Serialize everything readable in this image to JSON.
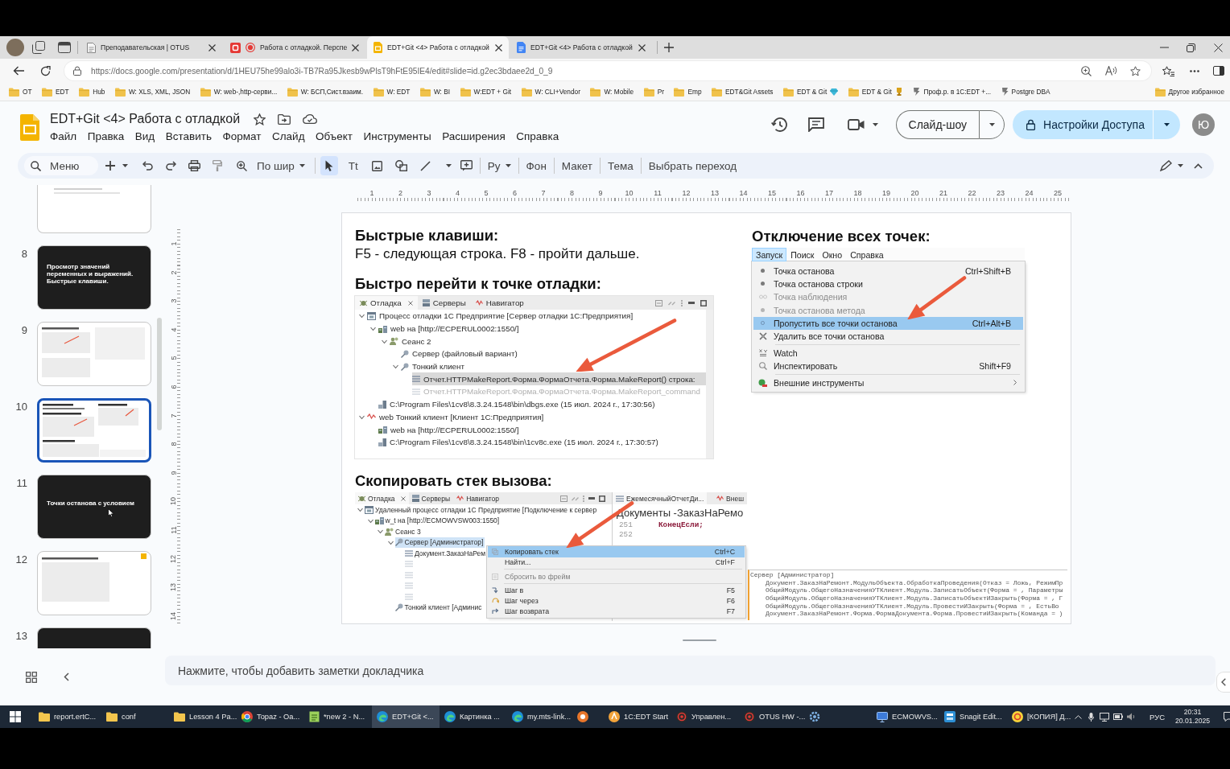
{
  "browser": {
    "tabs": [
      {
        "title": "Преподавательская | OTUS",
        "kind": "page",
        "recording": false,
        "selected": false
      },
      {
        "title": "Работа с отладкой. Перспе",
        "kind": "app",
        "recording": true,
        "selected": false
      },
      {
        "title": "EDT+Git <4> Работа с отладкой",
        "kind": "slides",
        "recording": false,
        "selected": true
      },
      {
        "title": "EDT+Git <4> Работа с отладкой",
        "kind": "docs",
        "recording": false,
        "selected": false
      }
    ],
    "url": "https://docs.google.com/presentation/d/1HEU75he99alo3i-TB7Ra95Jkesb9wPlsT9hFtE95IE4/edit#slide=id.g2ec3bdaee2d_0_9",
    "bookmarks": [
      {
        "label": "OT",
        "kind": "folder"
      },
      {
        "label": "EDT",
        "kind": "folder"
      },
      {
        "label": "Hub",
        "kind": "folder"
      },
      {
        "label": "W: XLS, XML, JSON",
        "kind": "folder"
      },
      {
        "label": "W: web-,http-серви...",
        "kind": "folder"
      },
      {
        "label": "W: БСП,Сист.взаим.",
        "kind": "folder"
      },
      {
        "label": "W: EDT",
        "kind": "folder"
      },
      {
        "label": "W: BI",
        "kind": "folder"
      },
      {
        "label": "W:EDT + Git",
        "kind": "folder"
      },
      {
        "label": "W: CLI+Vendor",
        "kind": "folder"
      },
      {
        "label": "W: Mobile",
        "kind": "folder"
      },
      {
        "label": "Pr",
        "kind": "folder"
      },
      {
        "label": "Emp",
        "kind": "folder"
      },
      {
        "label": "EDT&Git Assets",
        "kind": "folder"
      },
      {
        "label": "EDT & Git",
        "kind": "folder-gem"
      },
      {
        "label": "EDT & Git",
        "kind": "folder-trophy"
      },
      {
        "label": "Проф.р. в 1C:EDT +...",
        "kind": "site"
      },
      {
        "label": "Postgre DBA",
        "kind": "site"
      }
    ],
    "other_bookmarks": "Другое избранное"
  },
  "slides_app": {
    "title": "EDT+Git <4> Работа с отладкой",
    "menus": [
      "Файл",
      "Правка",
      "Вид",
      "Вставить",
      "Формат",
      "Слайд",
      "Объект",
      "Инструменты",
      "Расширения",
      "Справка"
    ],
    "slideshow_button": "Слайд-шоу",
    "share_button": "Настройки Доступа",
    "avatar": "Ю",
    "toolbar": {
      "menu_search": {
        "placeholder": "Меню"
      },
      "zoom": "По шир",
      "tools": [
        {
          "kind": "select",
          "selected": true
        },
        {
          "kind": "textbox",
          "glyph": "Tt",
          "selected": false
        },
        {
          "kind": "image",
          "selected": false
        },
        {
          "kind": "shape",
          "selected": false
        },
        {
          "kind": "line",
          "selected": false
        }
      ],
      "input_tools": "Ру",
      "actions": [
        "Фон",
        "Макет",
        "Тема",
        "Выбрать переход"
      ]
    }
  },
  "filmstrip": {
    "slides": [
      {
        "kind": "light",
        "selected": false
      },
      {
        "number": "8",
        "kind": "dark",
        "title": "Просмотр значений переменных и выражений. Быстрые клавиши.",
        "selected": false
      },
      {
        "number": "9",
        "kind": "light",
        "selected": false
      },
      {
        "number": "10",
        "kind": "light",
        "selected": true
      },
      {
        "number": "11",
        "kind": "dark",
        "title": "Точки останова с условием",
        "selected": false
      },
      {
        "number": "12",
        "kind": "light",
        "selected": false
      },
      {
        "number": "13",
        "kind": "dark",
        "selected": false
      }
    ]
  },
  "rulers": {
    "horizontal": [
      "1",
      "2",
      "3",
      "4",
      "5",
      "6",
      "7",
      "8",
      "9",
      "10",
      "11",
      "12",
      "13",
      "14",
      "15",
      "16",
      "17",
      "18",
      "19",
      "20",
      "21",
      "22",
      "23",
      "24",
      "25"
    ],
    "vertical": [
      "1",
      "2",
      "3",
      "4",
      "5",
      "6",
      "7",
      "8",
      "9",
      "10",
      "11",
      "12",
      "13",
      "14"
    ]
  },
  "slide": {
    "hotkeys": {
      "heading": "Быстрые клавиши:",
      "text": "F5 - следующая строка. F8 - пройти дальше."
    },
    "jump_to_breakpoint": {
      "heading": "Быстро перейти к точке отладки:",
      "view_tabs": [
        {
          "label": "Отладка",
          "kind": "debug",
          "closable": true,
          "selected": true
        },
        {
          "label": "Серверы",
          "kind": "servers",
          "closable": false,
          "selected": false
        },
        {
          "label": "Навигатор",
          "kind": "navigator",
          "closable": false,
          "selected": false
        }
      ],
      "tree": [
        {
          "label": "Процесс отладки 1С Предприятие [Сервер отладки 1С:Предприятия]",
          "kind": "process",
          "expanded": true,
          "selected": false,
          "children": [
            {
              "label": "web на [http://ECPERUL0002:1550/]",
              "kind": "target",
              "expanded": true,
              "selected": false,
              "children": [
                {
                  "label": "Сеанс 2",
                  "kind": "session",
                  "expanded": true,
                  "selected": false,
                  "children": [
                    {
                      "label": "Сервер (файловый вариант)",
                      "kind": "server",
                      "selected": false
                    },
                    {
                      "label": "Тонкий клиент",
                      "kind": "server",
                      "expanded": true,
                      "selected": false,
                      "children": [
                        {
                          "label": "Отчет.HTTPMakeReport.Форма.ФормаОтчета.Форма.MakeReport() строка:",
                          "kind": "frame",
                          "disabled": false,
                          "selected": true
                        },
                        {
                          "label": "Отчет.HTTPMakeReport.Форма.ФормаОтчета.Форма.MakeReport_command",
                          "kind": "frame",
                          "disabled": true,
                          "selected": false
                        }
                      ]
                    }
                  ]
                }
              ]
            },
            {
              "label": "C:\\Program Files\\1cv8\\8.3.24.1548\\bin\\dbgs.exe (15 июл. 2024 г., 17:30:56)",
              "kind": "exe",
              "selected": false
            }
          ]
        },
        {
          "label": "web Тонкий клиент [Клиент 1С:Предприятия]",
          "kind": "client",
          "expanded": true,
          "selected": false,
          "children": [
            {
              "label": "web на [http://ECPERUL0002:1550/]",
              "kind": "target",
              "selected": false
            },
            {
              "label": "C:\\Program Files\\1cv8\\8.3.24.1548\\bin\\1cv8c.exe (15 июл. 2024 г., 17:30:57)",
              "kind": "exe",
              "selected": false
            }
          ]
        }
      ]
    },
    "disable_all": {
      "heading": "Отключение всех точек:",
      "menu_bar": [
        {
          "label": "Запуск",
          "selected": true
        },
        {
          "label": "Поиск",
          "selected": false
        },
        {
          "label": "Окно",
          "selected": false
        },
        {
          "label": "Справка",
          "selected": false
        }
      ],
      "menu_groups": [
        {
          "items": [
            {
              "label": "Точка останова",
              "kind": "breakpoint",
              "shortcut": "Ctrl+Shift+B",
              "disabled": false,
              "selected": false
            },
            {
              "label": "Точка останова строки",
              "kind": "breakpoint",
              "disabled": false,
              "selected": false
            },
            {
              "label": "Точка наблюдения",
              "kind": "watchpoint",
              "disabled": true,
              "selected": false
            },
            {
              "label": "Точка останова метода",
              "kind": "breakpoint",
              "disabled": true,
              "selected": false
            },
            {
              "label": "Пропустить все точки останова",
              "kind": "skip",
              "shortcut": "Ctrl+Alt+B",
              "disabled": false,
              "selected": true
            },
            {
              "label": "Удалить все точки останова",
              "kind": "remove",
              "disabled": false,
              "selected": false
            }
          ]
        },
        {
          "items": [
            {
              "label": "Watch",
              "kind": "watch",
              "disabled": false,
              "selected": false
            },
            {
              "label": "Инспектировать",
              "kind": "inspect",
              "shortcut": "Shift+F9",
              "disabled": false,
              "selected": false
            }
          ]
        },
        {
          "items": [
            {
              "label": "Внешние инструменты",
              "kind": "external",
              "submenu": true,
              "disabled": false,
              "selected": false
            }
          ]
        }
      ]
    },
    "copy_stack": {
      "heading": "Скопировать стек вызова:",
      "view_tabs": [
        {
          "label": "Отладка",
          "kind": "debug",
          "closable": true,
          "selected": true
        },
        {
          "label": "Серверы",
          "kind": "servers",
          "closable": false,
          "selected": false
        },
        {
          "label": "Навигатор",
          "kind": "navigator",
          "closable": false,
          "selected": false
        }
      ],
      "tree": [
        {
          "label": "Удаленный процесс отладки 1С Предприятие [Подключение к сервер",
          "kind": "process",
          "expanded": true,
          "selected": false,
          "children": [
            {
              "label": "w_t на [http://ECMOWVSW003:1550]",
              "kind": "target",
              "expanded": true,
              "selected": false,
              "children": [
                {
                  "label": "Сеанс 3",
                  "kind": "session",
                  "expanded": true,
                  "selected": false,
                  "children": [
                    {
                      "label": "Сервер [Администратор]",
                      "kind": "server",
                      "expanded": true,
                      "selected": true,
                      "children": [
                        {
                          "label": "Документ.ЗаказНаРем",
                          "kind": "frame",
                          "disabled": false,
                          "selected": false
                        },
                        {
                          "kind": "frame",
                          "disabled": true,
                          "selected": false
                        },
                        {
                          "kind": "frame",
                          "disabled": true,
                          "selected": false
                        },
                        {
                          "kind": "frame",
                          "disabled": true,
                          "selected": false
                        },
                        {
                          "kind": "frame",
                          "disabled": true,
                          "selected": false
                        }
                      ]
                    },
                    {
                      "label": "Тонкий клиент [Админис",
                      "kind": "server",
                      "selected": false
                    }
                  ]
                }
              ]
            }
          ]
        }
      ],
      "editor": {
        "tabs": [
          {
            "label": "ЕжемесячныйОтчетДи...",
            "selected": true
          },
          {
            "label": "Внеш",
            "selected": false
          }
        ],
        "title": "Документы -ЗаказНаРемо",
        "lines": [
          {
            "number": "251",
            "code": "КонецЕсли;"
          },
          {
            "number": "252"
          }
        ]
      },
      "context_menu": [
        {
          "items": [
            {
              "label": "Копировать стек",
              "kind": "copy",
              "shortcut": "Ctrl+C",
              "disabled": false,
              "selected": true
            },
            {
              "label": "Найти...",
              "kind": "find",
              "shortcut": "Ctrl+F",
              "disabled": false,
              "selected": false
            }
          ]
        },
        {
          "items": [
            {
              "label": "Сбросить во фрейм",
              "kind": "drop",
              "disabled": true,
              "selected": false
            }
          ]
        },
        {
          "items": [
            {
              "label": "Шаг в",
              "kind": "step-into",
              "shortcut": "F5",
              "disabled": false,
              "selected": false
            },
            {
              "label": "Шаг через",
              "kind": "step-over",
              "shortcut": "F6",
              "disabled": false,
              "selected": false
            },
            {
              "label": "Шаг возврата",
              "kind": "step-return",
              "shortcut": "F7",
              "disabled": false,
              "selected": false
            }
          ]
        }
      ]
    },
    "console": {
      "header": "Сервер [Администратор]",
      "frames": [
        "Документ.ЗаказНаРемонт.МодульОбъекта.ОбработкаПроведения(Отказ = Ложь, РежимПр",
        "ОбщийМодуль.ОбщегоНазначенияУТКлиент.Модуль.ЗаписатьОбъект(Форма = , Параметры",
        "ОбщийМодуль.ОбщегоНазначенияУТКлиент.Модуль.ЗаписатьОбъектИЗакрыть(Форма = , Г",
        "ОбщийМодуль.ОбщегоНазначенияУТКлиент.Модуль.ПровестиИЗакрыть(Форма = , ЕстьВо",
        "Документ.ЗаказНаРемонт.Форма.ФормаДокумента.Форма.ПровестиИЗакрыть(Команда = )"
      ]
    }
  },
  "notes": {
    "placeholder": "Нажмите, чтобы добавить заметки докладчика"
  },
  "taskbar": {
    "items": [
      {
        "label": "report.ertC...",
        "kind": "folder",
        "selected": false
      },
      {
        "label": "conf",
        "kind": "folder",
        "selected": false
      },
      {
        "label": "Lesson 4 Pa...",
        "kind": "folder",
        "selected": false
      },
      {
        "label": "Topaz - Oa...",
        "kind": "chrome",
        "selected": false
      },
      {
        "label": "*new 2 - N...",
        "kind": "notepad",
        "selected": false
      },
      {
        "label": "EDT+Git <...",
        "kind": "edge",
        "selected": true
      },
      {
        "label": "Картинка ...",
        "kind": "edge",
        "selected": false
      },
      {
        "label": "my.mts-link...",
        "kind": "edge",
        "selected": false
      },
      {
        "kind": "orange-app",
        "selected": false
      },
      {
        "label": "1C:EDT Start",
        "kind": "edt",
        "selected": false
      },
      {
        "label": "Управлен...",
        "kind": "recorder",
        "selected": false
      },
      {
        "label": "OTUS HW -...",
        "kind": "recorder",
        "selected": false
      },
      {
        "kind": "gear-app",
        "selected": false
      },
      {
        "label": "ECMOWVS...",
        "kind": "remote",
        "selected": false
      },
      {
        "label": "Snagit Edit...",
        "kind": "snagit",
        "selected": false
      },
      {
        "label": "[КОПИЯ] Д...",
        "kind": "onec",
        "selected": false
      }
    ],
    "language": "РУС",
    "time": "20:31",
    "date": "20.01.2025"
  }
}
